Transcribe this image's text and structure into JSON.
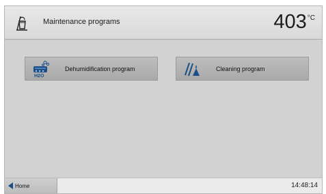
{
  "header": {
    "title": "Maintenance programs",
    "temperature_value": "403",
    "temperature_unit": "°C",
    "icon": "bucket-brush-icon"
  },
  "programs": [
    {
      "label": "Dehumidification program",
      "icon": "dehumidification-h2o-icon"
    },
    {
      "label": "Cleaning program",
      "icon": "cleaning-broom-icon"
    }
  ],
  "footer": {
    "home_label": "Home",
    "time": "14:48:14"
  },
  "colors": {
    "accent": "#1b4f8a",
    "background": "#d2d2d2",
    "button": "#b3b3b3"
  }
}
